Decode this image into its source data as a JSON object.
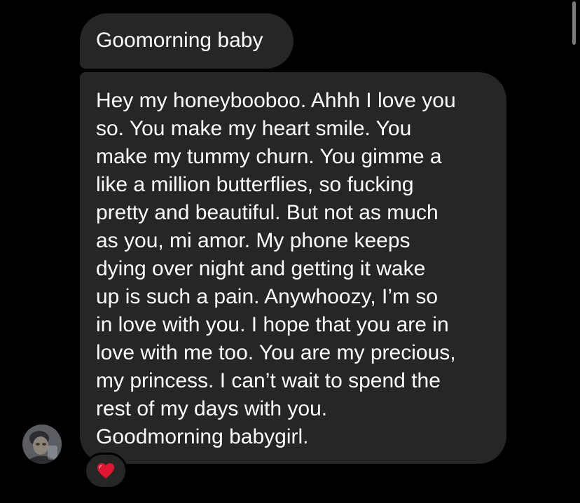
{
  "colors": {
    "background": "#000000",
    "bubble": "#262626",
    "text": "#ffffff",
    "heart": "#e0152f"
  },
  "thread": {
    "first_message": "Goomorning baby",
    "second_message_lines": [
      "Hey my honeybooboo. Ahhh I love you",
      "so. You make my heart smile. You",
      "make my tummy churn. You gimme a",
      "like a million butterflies, so fucking",
      "pretty and beautiful. But not as much",
      "as you, mi amor. My phone keeps",
      "dying over night and getting it wake",
      "up is such a pain. Anywhoozy, I’m so",
      "in love with you. I hope that you are in",
      "love with me too. You are my precious,",
      "my princess. I can’t wait to spend the",
      "rest of my days with you.",
      "Goodmorning babygirl."
    ],
    "reaction_icon": "red-heart-icon",
    "avatar_icon": "profile-photo"
  }
}
